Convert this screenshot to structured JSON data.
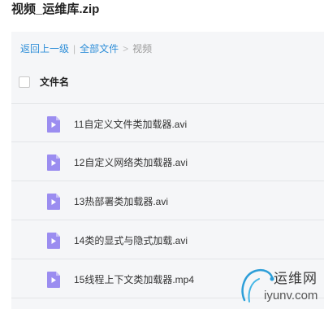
{
  "archive_title": "视频_运维库.zip",
  "breadcrumb": {
    "back": "返回上一级",
    "separator1": "|",
    "all_files": "全部文件",
    "separator2": ">",
    "current": "视频"
  },
  "table": {
    "column_name": "文件名"
  },
  "files": [
    {
      "name": "11自定义文件类加载器.avi",
      "icon": "video-file-icon"
    },
    {
      "name": "12自定义网络类加载器.avi",
      "icon": "video-file-icon"
    },
    {
      "name": "13热部署类加载器.avi",
      "icon": "video-file-icon"
    },
    {
      "name": "14类的显式与隐式加载.avi",
      "icon": "video-file-icon"
    },
    {
      "name": "15线程上下文类加载器.mp4",
      "icon": "video-file-icon"
    }
  ],
  "watermark": {
    "cn": "运维网",
    "en": "iyunv.com"
  },
  "colors": {
    "link": "#2f8fd8",
    "icon": "#9b8df0",
    "panel": "#f5f6f8"
  }
}
